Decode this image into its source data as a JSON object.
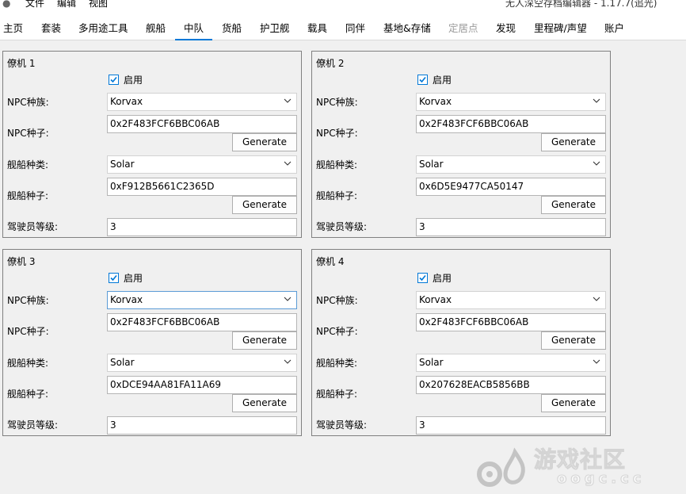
{
  "window": {
    "title": "无人深空存档编辑器 - 1.17.7(追光)",
    "menu": [
      "文件",
      "编辑",
      "视图"
    ]
  },
  "tabs": [
    {
      "label": "主页"
    },
    {
      "label": "套装"
    },
    {
      "label": "多用途工具"
    },
    {
      "label": "舰船"
    },
    {
      "label": "中队",
      "selected": true
    },
    {
      "label": "货船"
    },
    {
      "label": "护卫舰"
    },
    {
      "label": "载具"
    },
    {
      "label": "同伴"
    },
    {
      "label": "基地&存储"
    },
    {
      "label": "定居点",
      "disabled": true
    },
    {
      "label": "发现"
    },
    {
      "label": "里程碑/声望"
    },
    {
      "label": "账户"
    }
  ],
  "labels": {
    "enabled": "启用",
    "npc_race": "NPC种族:",
    "npc_seed": "NPC种子:",
    "ship_type": "舰船种类:",
    "ship_seed": "舰船种子:",
    "pilot_rank": "驾驶员等级:",
    "generate": "Generate"
  },
  "wingmen": [
    {
      "title": "僚机 1",
      "enabled": true,
      "npc_race": "Korvax",
      "npc_seed": "0x2F483FCF6BBC06AB",
      "ship_type": "Solar",
      "ship_seed": "0xF912B5661C2365D",
      "pilot_rank": "3"
    },
    {
      "title": "僚机 2",
      "enabled": true,
      "npc_race": "Korvax",
      "npc_seed": "0x2F483FCF6BBC06AB",
      "ship_type": "Solar",
      "ship_seed": "0x6D5E9477CA50147",
      "pilot_rank": "3"
    },
    {
      "title": "僚机 3",
      "enabled": true,
      "npc_race": "Korvax",
      "npc_seed": "0x2F483FCF6BBC06AB",
      "ship_type": "Solar",
      "ship_seed": "0xDCE94AA81FA11A69",
      "pilot_rank": "3"
    },
    {
      "title": "僚机 4",
      "enabled": true,
      "npc_race": "Korvax",
      "npc_seed": "0x2F483FCF6BBC06AB",
      "ship_type": "Solar",
      "ship_seed": "0x207628EACB5856BB",
      "pilot_rank": "3"
    }
  ],
  "watermark": {
    "text": "游戏社区",
    "url": "oogc.cc"
  },
  "colors": {
    "accent": "#0078d7",
    "background": "#f0f0f0"
  }
}
